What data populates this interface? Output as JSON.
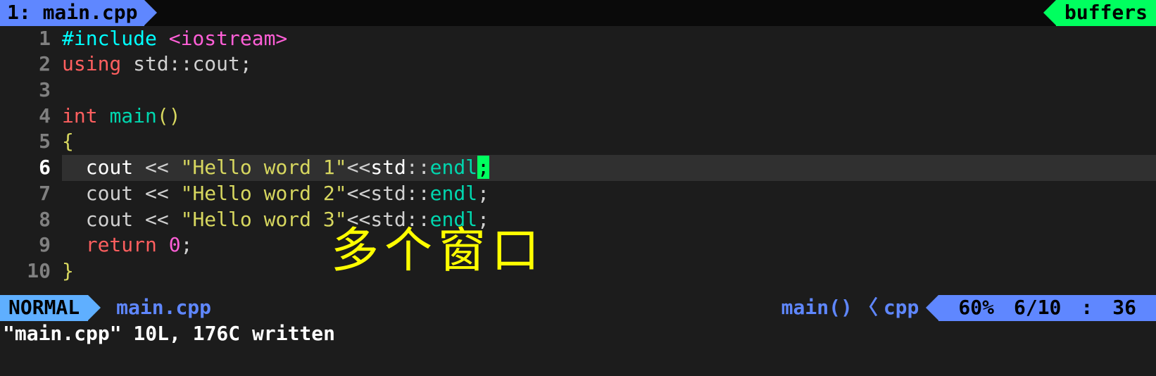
{
  "tabline": {
    "active_tab": "1: main.cpp",
    "right_label": "buffers"
  },
  "source": {
    "lines": [
      {
        "n": "1",
        "cur": false,
        "frags": [
          {
            "cls": "c-pre",
            "t": "#include "
          },
          {
            "cls": "c-header",
            "t": "<iostream>"
          }
        ]
      },
      {
        "n": "2",
        "cur": false,
        "frags": [
          {
            "cls": "c-kw",
            "t": "using"
          },
          {
            "cls": "c-ns",
            "t": " std"
          },
          {
            "cls": "c-op",
            "t": "::"
          },
          {
            "cls": "c-ns",
            "t": "cout"
          },
          {
            "cls": "c-op",
            "t": ";"
          }
        ]
      },
      {
        "n": "3",
        "cur": false,
        "frags": []
      },
      {
        "n": "4",
        "cur": false,
        "frags": [
          {
            "cls": "c-kw",
            "t": "int"
          },
          {
            "cls": "c-ns",
            "t": " "
          },
          {
            "cls": "c-ident",
            "t": "main"
          },
          {
            "cls": "c-paren",
            "t": "()"
          }
        ]
      },
      {
        "n": "5",
        "cur": false,
        "frags": [
          {
            "cls": "c-brace",
            "t": "{"
          }
        ]
      },
      {
        "n": "6",
        "cur": true,
        "frags": [
          {
            "cls": "c-white",
            "t": "  cout "
          },
          {
            "cls": "c-op",
            "t": "<<"
          },
          {
            "cls": "c-white",
            "t": " "
          },
          {
            "cls": "c-str",
            "t": "\"Hello word 1\""
          },
          {
            "cls": "c-op",
            "t": "<<"
          },
          {
            "cls": "c-white",
            "t": "std"
          },
          {
            "cls": "c-op",
            "t": "::"
          },
          {
            "cls": "c-ident",
            "t": "endl"
          },
          {
            "cls": "cursor",
            "t": ";"
          }
        ]
      },
      {
        "n": "7",
        "cur": false,
        "frags": [
          {
            "cls": "c-ns",
            "t": "  cout "
          },
          {
            "cls": "c-op",
            "t": "<<"
          },
          {
            "cls": "c-ns",
            "t": " "
          },
          {
            "cls": "c-str",
            "t": "\"Hello word 2\""
          },
          {
            "cls": "c-op",
            "t": "<<"
          },
          {
            "cls": "c-ns",
            "t": "std"
          },
          {
            "cls": "c-op",
            "t": "::"
          },
          {
            "cls": "c-ident",
            "t": "endl"
          },
          {
            "cls": "c-op",
            "t": ";"
          }
        ]
      },
      {
        "n": "8",
        "cur": false,
        "frags": [
          {
            "cls": "c-ns",
            "t": "  cout "
          },
          {
            "cls": "c-op",
            "t": "<<"
          },
          {
            "cls": "c-ns",
            "t": " "
          },
          {
            "cls": "c-str",
            "t": "\"Hello word 3\""
          },
          {
            "cls": "c-op",
            "t": "<<"
          },
          {
            "cls": "c-ns",
            "t": "std"
          },
          {
            "cls": "c-op",
            "t": "::"
          },
          {
            "cls": "c-ident",
            "t": "endl"
          },
          {
            "cls": "c-op",
            "t": ";"
          }
        ]
      },
      {
        "n": "9",
        "cur": false,
        "frags": [
          {
            "cls": "c-ns",
            "t": "  "
          },
          {
            "cls": "c-kw",
            "t": "return"
          },
          {
            "cls": "c-ns",
            "t": " "
          },
          {
            "cls": "c-num",
            "t": "0"
          },
          {
            "cls": "c-op",
            "t": ";"
          }
        ]
      },
      {
        "n": "10",
        "cur": false,
        "frags": [
          {
            "cls": "c-brace",
            "t": "}"
          }
        ]
      }
    ]
  },
  "overlay_text": "多个窗口",
  "statusline": {
    "mode": "NORMAL",
    "file": "main.cpp",
    "func": "main()",
    "filetype": "cpp",
    "percent": "60%",
    "lineinfo": "6/10",
    "sep": ":",
    "col": "36"
  },
  "message": "\"main.cpp\" 10L, 176C written"
}
